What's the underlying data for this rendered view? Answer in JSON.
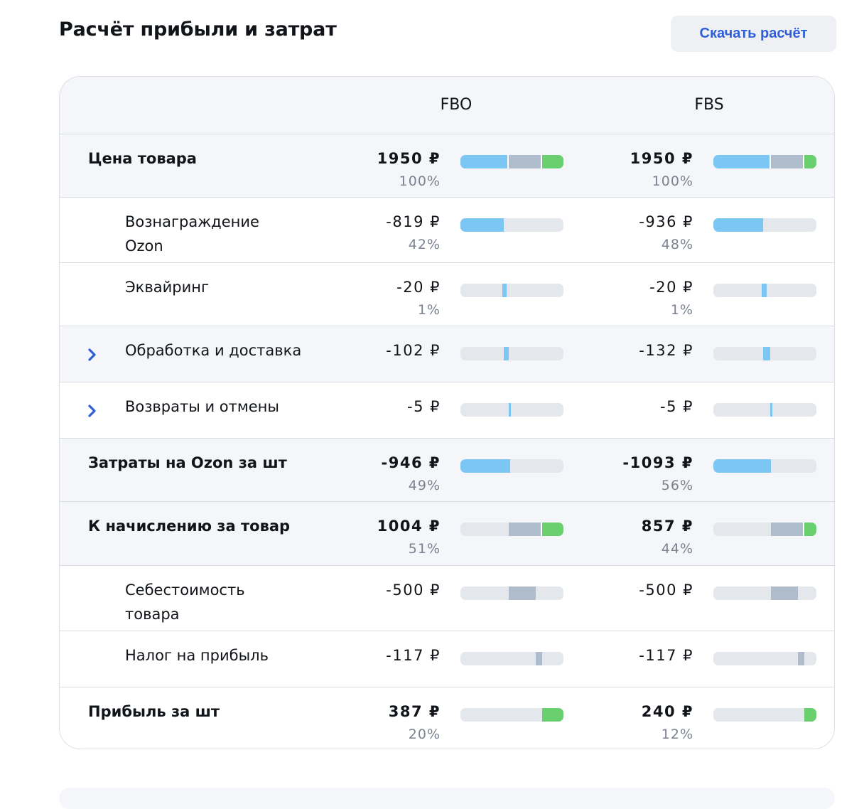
{
  "page": {
    "title": "Расчёт прибыли и затрат",
    "download_label": "Скачать расчёт"
  },
  "colors": {
    "commission": "#7cc6f4",
    "cost": "#aebccb",
    "profit": "#6ad06f",
    "track": "#e4e7ec",
    "accent": "#2e5fd6"
  },
  "table": {
    "columns": [
      "FBO",
      "FBS"
    ],
    "rows": [
      {
        "label": "Цена товара",
        "bold": true,
        "shaded": true,
        "expandable": false,
        "fbo": {
          "value": "1950 ₽",
          "pct": "100%",
          "bar": [
            [
              "blue",
              0,
              0.47,
              true
            ],
            [
              "gray",
              0.47,
              0.79,
              true
            ],
            [
              "green",
              0.79,
              1,
              false
            ]
          ]
        },
        "fbs": {
          "value": "1950 ₽",
          "pct": "100%",
          "bar": [
            [
              "blue",
              0,
              0.56,
              true
            ],
            [
              "gray",
              0.56,
              0.88,
              true
            ],
            [
              "green",
              0.88,
              1,
              false
            ]
          ]
        }
      },
      {
        "label": "Вознаграждение Ozon",
        "bold": false,
        "shaded": false,
        "expandable": false,
        "fbo": {
          "value": "-819 ₽",
          "pct": "42%",
          "bar": [
            [
              "blue",
              0,
              0.42,
              false
            ]
          ]
        },
        "fbs": {
          "value": "-936 ₽",
          "pct": "48%",
          "bar": [
            [
              "blue",
              0,
              0.48,
              false
            ]
          ]
        }
      },
      {
        "label": "Эквайринг",
        "bold": false,
        "shaded": false,
        "expandable": false,
        "fbo": {
          "value": "-20 ₽",
          "pct": "1%",
          "bar": [
            [
              "blue",
              0.41,
              0.45,
              false
            ]
          ]
        },
        "fbs": {
          "value": "-20 ₽",
          "pct": "1%",
          "bar": [
            [
              "blue",
              0.47,
              0.52,
              false
            ]
          ]
        }
      },
      {
        "label": "Обработка  и доставка",
        "bold": false,
        "shaded": true,
        "expandable": true,
        "fbo": {
          "value": "-102 ₽",
          "pct": "",
          "bar": [
            [
              "blue",
              0.42,
              0.47,
              false
            ]
          ]
        },
        "fbs": {
          "value": "-132 ₽",
          "pct": "",
          "bar": [
            [
              "blue",
              0.48,
              0.55,
              false
            ]
          ]
        }
      },
      {
        "label": "Возвраты и отмены",
        "bold": false,
        "shaded": false,
        "expandable": true,
        "fbo": {
          "value": "-5 ₽",
          "pct": "",
          "bar": [
            [
              "blue",
              0.47,
              0.49,
              false
            ]
          ]
        },
        "fbs": {
          "value": "-5 ₽",
          "pct": "",
          "bar": [
            [
              "blue",
              0.55,
              0.57,
              false
            ]
          ]
        }
      },
      {
        "label": "Затраты на Ozon за шт",
        "bold": true,
        "shaded": true,
        "expandable": false,
        "fbo": {
          "value": "-946 ₽",
          "pct": "49%",
          "bar": [
            [
              "blue",
              0,
              0.48,
              false
            ]
          ]
        },
        "fbs": {
          "value": "-1093 ₽",
          "pct": "56%",
          "bar": [
            [
              "blue",
              0,
              0.56,
              false
            ]
          ]
        }
      },
      {
        "label": "К начислению за товар",
        "bold": true,
        "shaded": true,
        "expandable": false,
        "fbo": {
          "value": "1004 ₽",
          "pct": "51%",
          "bar": [
            [
              "gray",
              0.47,
              0.79,
              true
            ],
            [
              "green",
              0.79,
              1,
              false
            ]
          ]
        },
        "fbs": {
          "value": "857 ₽",
          "pct": "44%",
          "bar": [
            [
              "gray",
              0.56,
              0.88,
              true
            ],
            [
              "green",
              0.88,
              1,
              false
            ]
          ]
        }
      },
      {
        "label": "Себестоимость товара",
        "bold": false,
        "shaded": false,
        "expandable": false,
        "fbo": {
          "value": "-500 ₽",
          "pct": "",
          "bar": [
            [
              "gray",
              0.47,
              0.73,
              false
            ]
          ]
        },
        "fbs": {
          "value": "-500 ₽",
          "pct": "",
          "bar": [
            [
              "gray",
              0.56,
              0.82,
              false
            ]
          ]
        }
      },
      {
        "label": "Налог на прибыль",
        "bold": false,
        "shaded": false,
        "expandable": false,
        "fbo": {
          "value": "-117 ₽",
          "pct": "",
          "bar": [
            [
              "gray",
              0.73,
              0.79,
              false
            ]
          ]
        },
        "fbs": {
          "value": "-117 ₽",
          "pct": "",
          "bar": [
            [
              "gray",
              0.82,
              0.88,
              false
            ]
          ]
        }
      },
      {
        "label": "Прибыль за шт",
        "bold": true,
        "shaded": false,
        "expandable": false,
        "fbo": {
          "value": "387 ₽",
          "pct": "20%",
          "bar": [
            [
              "green",
              0.79,
              1,
              false
            ]
          ]
        },
        "fbs": {
          "value": "240 ₽",
          "pct": "12%",
          "bar": [
            [
              "green",
              0.88,
              1,
              false
            ]
          ]
        }
      }
    ]
  }
}
